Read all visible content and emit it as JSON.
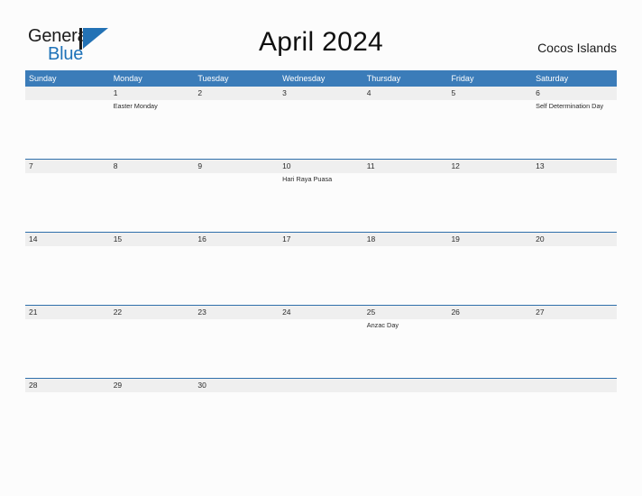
{
  "brand": {
    "name_part1": "General",
    "name_part2": "Blue",
    "mark": "triangle-logo-icon"
  },
  "header": {
    "title": "April 2024",
    "location": "Cocos Islands"
  },
  "calendar": {
    "weekdays": [
      "Sunday",
      "Monday",
      "Tuesday",
      "Wednesday",
      "Thursday",
      "Friday",
      "Saturday"
    ],
    "colors": {
      "header_blue": "#3b7cb9",
      "rule_blue": "#2f6fab",
      "date_band_gray": "#efefef",
      "logo_blue": "#1e72b8",
      "page_background": "#fcfcfc",
      "text": "#2b2b2b"
    },
    "weeks": [
      {
        "days": [
          {
            "number": "",
            "events": []
          },
          {
            "number": "1",
            "events": [
              "Easter Monday"
            ]
          },
          {
            "number": "2",
            "events": []
          },
          {
            "number": "3",
            "events": []
          },
          {
            "number": "4",
            "events": []
          },
          {
            "number": "5",
            "events": []
          },
          {
            "number": "6",
            "events": [
              "Self Determination Day"
            ]
          }
        ]
      },
      {
        "days": [
          {
            "number": "7",
            "events": []
          },
          {
            "number": "8",
            "events": []
          },
          {
            "number": "9",
            "events": []
          },
          {
            "number": "10",
            "events": [
              "Hari Raya Puasa"
            ]
          },
          {
            "number": "11",
            "events": []
          },
          {
            "number": "12",
            "events": []
          },
          {
            "number": "13",
            "events": []
          }
        ]
      },
      {
        "days": [
          {
            "number": "14",
            "events": []
          },
          {
            "number": "15",
            "events": []
          },
          {
            "number": "16",
            "events": []
          },
          {
            "number": "17",
            "events": []
          },
          {
            "number": "18",
            "events": []
          },
          {
            "number": "19",
            "events": []
          },
          {
            "number": "20",
            "events": []
          }
        ]
      },
      {
        "days": [
          {
            "number": "21",
            "events": []
          },
          {
            "number": "22",
            "events": []
          },
          {
            "number": "23",
            "events": []
          },
          {
            "number": "24",
            "events": []
          },
          {
            "number": "25",
            "events": [
              "Anzac Day"
            ]
          },
          {
            "number": "26",
            "events": []
          },
          {
            "number": "27",
            "events": []
          }
        ]
      },
      {
        "days": [
          {
            "number": "28",
            "events": []
          },
          {
            "number": "29",
            "events": []
          },
          {
            "number": "30",
            "events": []
          },
          {
            "number": "",
            "events": []
          },
          {
            "number": "",
            "events": []
          },
          {
            "number": "",
            "events": []
          },
          {
            "number": "",
            "events": []
          }
        ]
      }
    ]
  }
}
